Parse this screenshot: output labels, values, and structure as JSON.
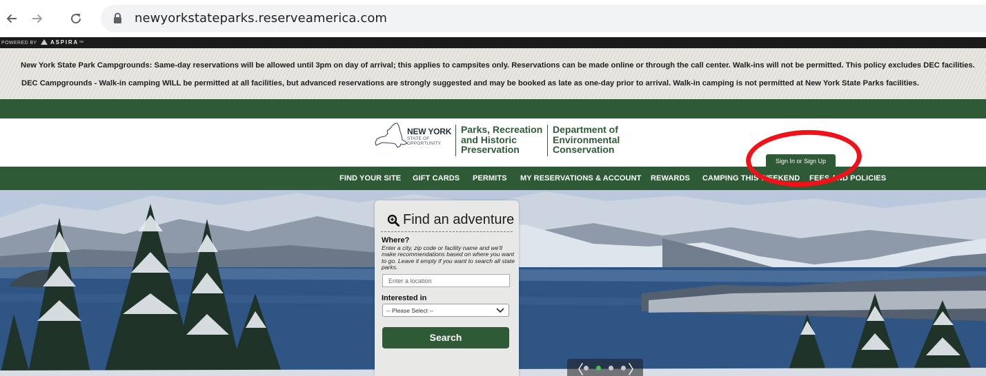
{
  "browser": {
    "url": "newyorkstateparks.reserveamerica.com",
    "back_icon": "arrow-left-icon",
    "forward_icon": "arrow-right-icon",
    "reload_icon": "reload-icon",
    "lock_icon": "lock-icon"
  },
  "aspira": {
    "powered_by": "POWERED BY",
    "brand": "ASPIRA",
    "mark": "™"
  },
  "alerts": [
    "New York State Park Campgrounds: Same-day reservations will be allowed until 3pm on day of arrival; this applies to campsites only. Reservations can be made online or through the call center. Walk-ins will not be permitted. This policy excludes DEC facilities.",
    "DEC Campgrounds - Walk-in camping WILL be permitted at all facilities, but advanced reservations are strongly suggested and may be booked as late as one-day prior to arrival. Walk-in camping is not permitted at New York State Parks facilities."
  ],
  "header": {
    "ny_title": "NEW YORK",
    "ny_sub_1": "STATE OF",
    "ny_sub_2": "OPPORTUNITY.",
    "parks_line_1": "Parks, Recreation",
    "parks_line_2": "and Historic",
    "parks_line_3": "Preservation",
    "dec_line_1": "Department of",
    "dec_line_2": "Environmental",
    "dec_line_3": "Conservation",
    "sign_in": "Sign In or Sign Up"
  },
  "nav": {
    "items": [
      "FIND YOUR SITE",
      "GIFT CARDS",
      "PERMITS",
      "MY RESERVATIONS & ACCOUNT",
      "REWARDS",
      "CAMPING THIS WEEKEND",
      "FEES AND POLICIES"
    ]
  },
  "search": {
    "title": "Find an adventure",
    "title_icon": "magnifier-plus-icon",
    "where_label": "Where?",
    "where_help": "Enter a city, zip code or facility name and we'll make recommendations based on where you want to go. Leave it empty if you want to search all state parks.",
    "location_placeholder": "Enter a location",
    "interested_label": "Interested in",
    "interested_value": "-- Please Select --",
    "button": "Search"
  },
  "carousel": {
    "prev": "〈",
    "next": "〉",
    "slide_count": 4,
    "active_slide": 2
  },
  "colors": {
    "brand_green": "#2e5a36",
    "highlight_red": "#f01218",
    "carousel_active": "#46c04a"
  }
}
